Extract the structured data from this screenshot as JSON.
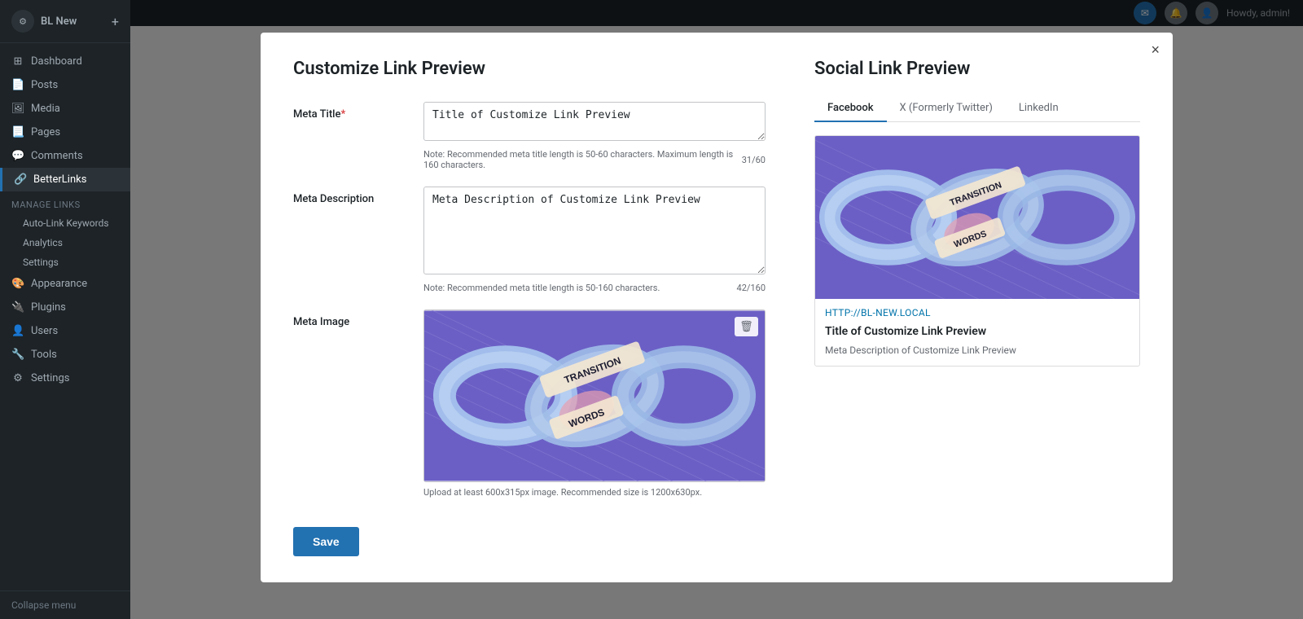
{
  "sidebar": {
    "site_name": "BL New",
    "menu_items": [
      {
        "id": "dashboard",
        "label": "Dashboard",
        "icon": "⊞"
      },
      {
        "id": "posts",
        "label": "Posts",
        "icon": "📄"
      },
      {
        "id": "media",
        "label": "Media",
        "icon": "🖼"
      },
      {
        "id": "pages",
        "label": "Pages",
        "icon": "📃"
      },
      {
        "id": "comments",
        "label": "Comments",
        "icon": "💬"
      },
      {
        "id": "betterlinks",
        "label": "BetterLinks",
        "icon": "🔗",
        "active": true
      }
    ],
    "manage_links_label": "Manage Links",
    "submenu_items": [
      {
        "id": "auto-link",
        "label": "Auto-Link Keywords"
      },
      {
        "id": "analytics",
        "label": "Analytics"
      },
      {
        "id": "settings",
        "label": "Settings"
      }
    ],
    "appearance": "Appearance",
    "plugins": "Plugins",
    "users": "Users",
    "tools": "Tools",
    "settings_bottom": "Settings",
    "collapse": "Collapse menu"
  },
  "topbar": {
    "user_text": "Howdy, admin!",
    "btn1_icon": "✉",
    "btn2_icon": "🔔"
  },
  "modal": {
    "close_label": "×",
    "left_title": "Customize Link Preview",
    "right_title": "Social Link Preview",
    "meta_title_label": "Meta Title",
    "meta_title_required": true,
    "meta_title_value": "Title of Customize Link Preview",
    "meta_title_note": "Note: Recommended meta title length is 50-60 characters. Maximum length is 160 characters.",
    "meta_title_count": "31/60",
    "meta_description_label": "Meta Description",
    "meta_description_value": "Meta Description of Customize Link Preview",
    "meta_description_note": "Note: Recommended meta title length is 50-160 characters.",
    "meta_description_count": "42/160",
    "meta_image_label": "Meta Image",
    "meta_image_note": "Upload at least 600x315px image. Recommended size is 1200x630px.",
    "save_button": "Save",
    "social_tabs": [
      {
        "id": "facebook",
        "label": "Facebook",
        "active": true
      },
      {
        "id": "twitter",
        "label": "X (Formerly Twitter)",
        "active": false
      },
      {
        "id": "linkedin",
        "label": "LinkedIn",
        "active": false
      }
    ],
    "preview_url": "HTTP://BL-NEW.LOCAL",
    "preview_title": "Title of Customize Link Preview",
    "preview_description": "Meta Description of Customize Link Preview"
  }
}
